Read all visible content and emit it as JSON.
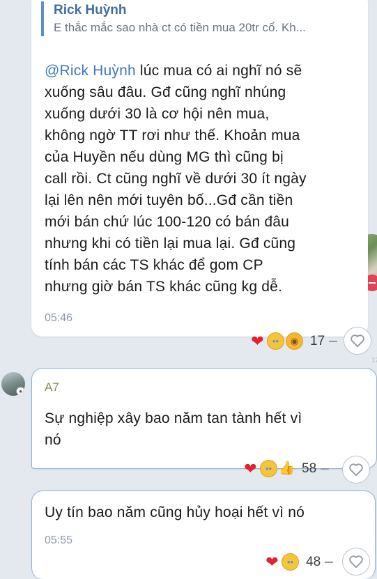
{
  "messages": [
    {
      "quote": {
        "name": "Rick Huỳnh",
        "text": "E thắc mắc sao nhà ct có tiền mua 20tr cổ. Kh..."
      },
      "mention": "@Rick Huỳnh",
      "lines": [
        " lúc mua có ai nghĩ nó sẽ",
        "xuống sâu đâu. Gđ cũng nghĩ nhúng",
        "xuống dưới 30 là cơ hội nên mua,",
        "không ngờ TT rơi như thế. Khoản mua",
        "của Huyền nếu dùng MG thì cũng bị",
        "call rồi. Ct cũng nghĩ về dưới 30 ít ngày",
        "lại lên nên mới tuyên bố...Gđ cần tiền",
        "mới bán chứ lúc 100-120 có bán đâu",
        "nhưng khi có tiền lại mua lại. Gđ cũng",
        "tính bán các TS khác để gom CP",
        "nhưng giờ bán TS khác cũng kg dễ."
      ],
      "time": "05:46",
      "reactions": {
        "emojis": [
          "heart",
          "cry",
          "sob"
        ],
        "count": "17"
      }
    },
    {
      "sender": "A7",
      "lines": [
        "Sự nghiệp xây bao năm tan tành hết vì",
        "nó"
      ],
      "reactions": {
        "emojis": [
          "heart",
          "cry",
          "thumbs-up"
        ],
        "count": "58"
      }
    },
    {
      "lines": [
        "Uy tín bao năm cũng hủy hoại hết vì nó"
      ],
      "time": "05:55",
      "reactions": {
        "emojis": [
          "heart",
          "cry"
        ],
        "count": "48"
      }
    }
  ],
  "icons": {
    "like": "heart-outline-icon",
    "avatar_badge": "person-badge-icon"
  },
  "colors": {
    "background": "#e4e9f0",
    "mention": "#3b78bf",
    "quote_bar": "#5b8fc7",
    "time": "#8f98a3"
  }
}
